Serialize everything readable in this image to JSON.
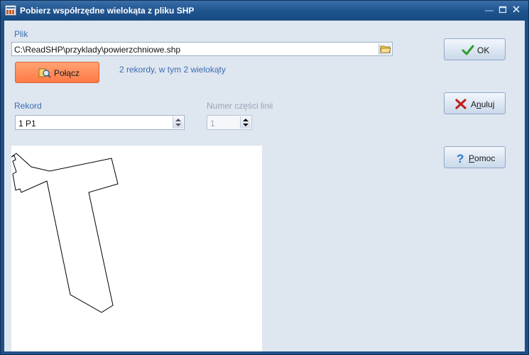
{
  "window": {
    "title": "Pobierz współrzędne wielokąta z pliku SHP"
  },
  "file": {
    "label": "Plik",
    "path": "C:\\ReadSHP\\przyklady\\powierzchniowe.shp"
  },
  "connect": {
    "label": "Połącz"
  },
  "info": {
    "text": "2 rekordy, w tym 2 wielokąty"
  },
  "record": {
    "label": "Rekord",
    "value": "1 P1"
  },
  "part": {
    "label": "Numer części linii",
    "value": "1"
  },
  "buttons": {
    "ok": "OK",
    "cancel_first": "A",
    "cancel_underlined": "n",
    "cancel_rest": "uluj",
    "help_first": "",
    "help_underlined": "P",
    "help_rest": "omoc"
  },
  "colors": {
    "title_bar": "#1f548f",
    "client_bg": "#dee6f0",
    "connect_btn": "#ff8a55",
    "label_blue": "#3b6eb0",
    "ok_check": "#2e9e2e",
    "cancel_x": "#c0201c",
    "help_q": "#2a78c8"
  },
  "icons": {
    "app": "app-icon",
    "browse": "folder-open-icon",
    "connect": "connect-icon",
    "ok": "check-icon",
    "cancel": "x-icon",
    "help": "question-icon"
  }
}
